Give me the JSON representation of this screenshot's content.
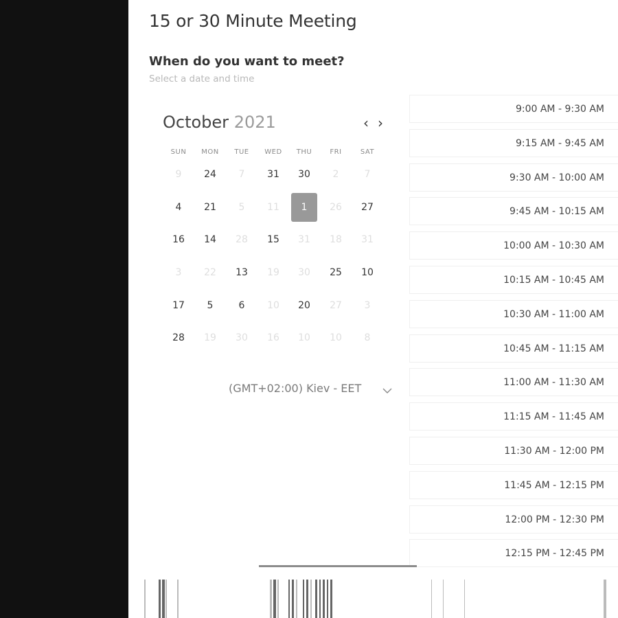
{
  "page": {
    "title": "15 or 30 Minute Meeting",
    "subheading": "When do you want to meet?",
    "subnote": "Select a date and time"
  },
  "calendar": {
    "month": "October",
    "year": "2021",
    "prev_symbol": "‹",
    "next_symbol": "›",
    "weekdays": [
      "SUN",
      "MON",
      "TUE",
      "WED",
      "THU",
      "FRI",
      "SAT"
    ],
    "weeks": [
      [
        {
          "d": "9",
          "on": false
        },
        {
          "d": "24",
          "on": true
        },
        {
          "d": "7",
          "on": false
        },
        {
          "d": "31",
          "on": true
        },
        {
          "d": "30",
          "on": true
        },
        {
          "d": "2",
          "on": false
        },
        {
          "d": "7",
          "on": false
        }
      ],
      [
        {
          "d": "4",
          "on": true
        },
        {
          "d": "21",
          "on": true
        },
        {
          "d": "5",
          "on": false
        },
        {
          "d": "11",
          "on": false
        },
        {
          "d": "1",
          "on": true,
          "selected": true
        },
        {
          "d": "26",
          "on": false
        },
        {
          "d": "27",
          "on": true
        }
      ],
      [
        {
          "d": "16",
          "on": true
        },
        {
          "d": "14",
          "on": true
        },
        {
          "d": "28",
          "on": false
        },
        {
          "d": "15",
          "on": true
        },
        {
          "d": "31",
          "on": false
        },
        {
          "d": "18",
          "on": false
        },
        {
          "d": "31",
          "on": false
        }
      ],
      [
        {
          "d": "3",
          "on": false
        },
        {
          "d": "22",
          "on": false
        },
        {
          "d": "13",
          "on": true
        },
        {
          "d": "19",
          "on": false
        },
        {
          "d": "30",
          "on": false
        },
        {
          "d": "25",
          "on": true
        },
        {
          "d": "10",
          "on": true
        }
      ],
      [
        {
          "d": "17",
          "on": true
        },
        {
          "d": "5",
          "on": true
        },
        {
          "d": "6",
          "on": true
        },
        {
          "d": "10",
          "on": false
        },
        {
          "d": "20",
          "on": true
        },
        {
          "d": "27",
          "on": false
        },
        {
          "d": "3",
          "on": false
        }
      ],
      [
        {
          "d": "28",
          "on": true
        },
        {
          "d": "19",
          "on": false
        },
        {
          "d": "30",
          "on": false
        },
        {
          "d": "16",
          "on": false
        },
        {
          "d": "10",
          "on": false
        },
        {
          "d": "10",
          "on": false
        },
        {
          "d": "8",
          "on": false
        }
      ]
    ]
  },
  "timezone": {
    "label": "(GMT+02:00) Kiev - EET"
  },
  "time_slots": [
    "9:00 AM - 9:30 AM",
    "9:15 AM - 9:45 AM",
    "9:30 AM - 10:00 AM",
    "9:45 AM - 10:15 AM",
    "10:00 AM - 10:30 AM",
    "10:15 AM - 10:45 AM",
    "10:30 AM - 11:00 AM",
    "10:45 AM - 11:15 AM",
    "11:00 AM - 11:30 AM",
    "11:15 AM - 11:45 AM",
    "11:30 AM - 12:00 PM",
    "11:45 AM - 12:15 PM",
    "12:00 PM - 12:30 PM",
    "12:15 PM - 12:45 PM"
  ],
  "colors": {
    "selected_day": "#999999",
    "sidebar": "#111111"
  }
}
